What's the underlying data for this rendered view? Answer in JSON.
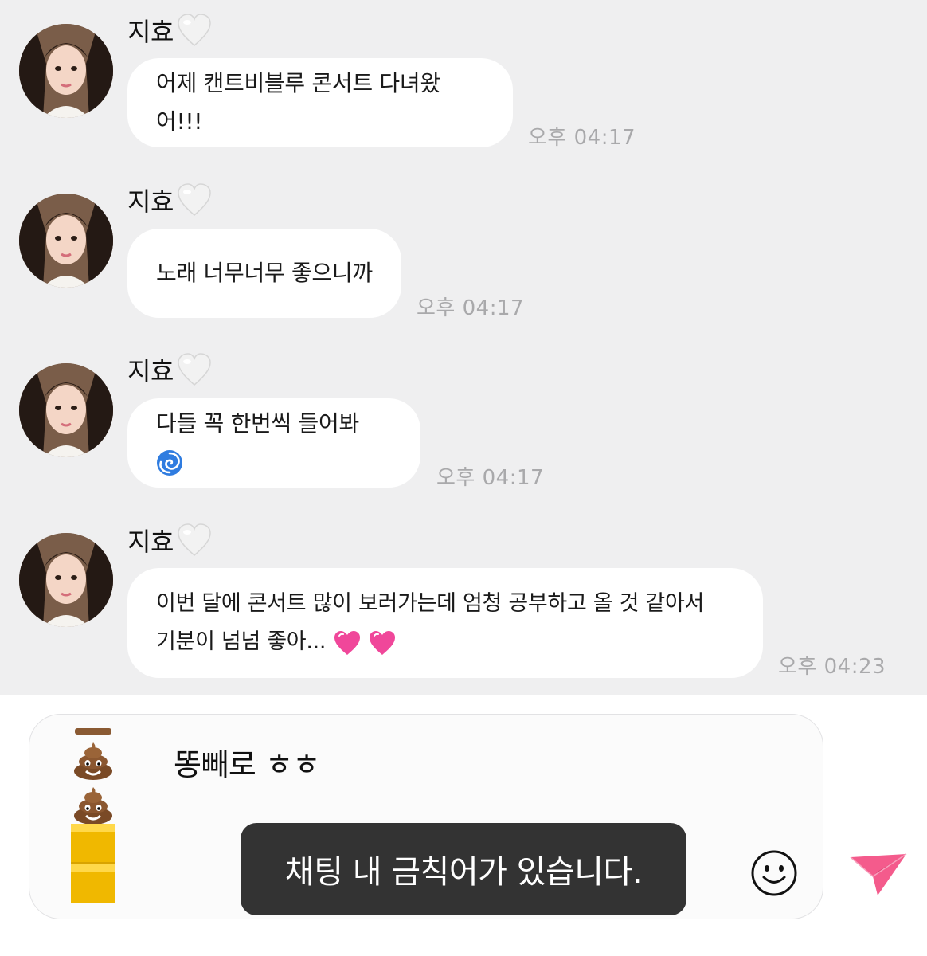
{
  "messages": [
    {
      "sender": "지효",
      "lines": [
        "어제 캔트비블루 콘서트 다녀왔어!!!"
      ],
      "time": "오후 04:17",
      "emoji": ""
    },
    {
      "sender": "지효",
      "lines": [
        "노래 너무너무 좋으니까"
      ],
      "time": "오후 04:17",
      "emoji": ""
    },
    {
      "sender": "지효",
      "lines": [
        "다들 꼭 한번씩 들어봐"
      ],
      "time": "오후 04:17",
      "emoji": "cyclone-emoji"
    },
    {
      "sender": "지효",
      "lines": [
        "이번 달에 콘서트 많이 보러가는데 엄청 공부하고 올 것 같아서",
        "기분이 넘넘 좋아..."
      ],
      "time": "오후 04:23",
      "emoji": "growing-heart-emoji"
    }
  ],
  "composer": {
    "input_text": "똥빼로 ㅎㅎ",
    "sticker": "poop-gold-stack-sticker",
    "emoji_button_icon": "smiley-icon",
    "send_button_icon": "paper-plane-icon"
  },
  "toast": {
    "text": "채팅 내 금칙어가 있습니다."
  },
  "colors": {
    "chat_background": "#efeff0",
    "bubble": "#ffffff",
    "toast_background": "#333333",
    "send_accent": "#f45b8c",
    "time_text": "#a9a9ab"
  }
}
